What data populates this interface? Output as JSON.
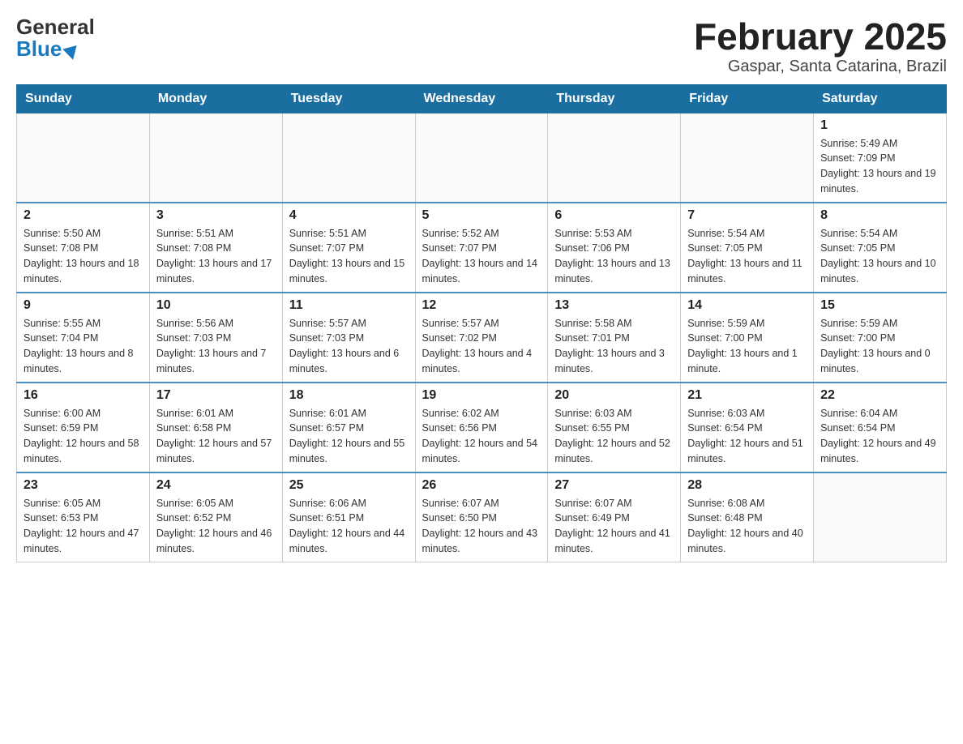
{
  "header": {
    "logo_general": "General",
    "logo_blue": "Blue",
    "month_title": "February 2025",
    "location": "Gaspar, Santa Catarina, Brazil"
  },
  "days_of_week": [
    "Sunday",
    "Monday",
    "Tuesday",
    "Wednesday",
    "Thursday",
    "Friday",
    "Saturday"
  ],
  "weeks": [
    [
      {
        "day": "",
        "info": ""
      },
      {
        "day": "",
        "info": ""
      },
      {
        "day": "",
        "info": ""
      },
      {
        "day": "",
        "info": ""
      },
      {
        "day": "",
        "info": ""
      },
      {
        "day": "",
        "info": ""
      },
      {
        "day": "1",
        "info": "Sunrise: 5:49 AM\nSunset: 7:09 PM\nDaylight: 13 hours and 19 minutes."
      }
    ],
    [
      {
        "day": "2",
        "info": "Sunrise: 5:50 AM\nSunset: 7:08 PM\nDaylight: 13 hours and 18 minutes."
      },
      {
        "day": "3",
        "info": "Sunrise: 5:51 AM\nSunset: 7:08 PM\nDaylight: 13 hours and 17 minutes."
      },
      {
        "day": "4",
        "info": "Sunrise: 5:51 AM\nSunset: 7:07 PM\nDaylight: 13 hours and 15 minutes."
      },
      {
        "day": "5",
        "info": "Sunrise: 5:52 AM\nSunset: 7:07 PM\nDaylight: 13 hours and 14 minutes."
      },
      {
        "day": "6",
        "info": "Sunrise: 5:53 AM\nSunset: 7:06 PM\nDaylight: 13 hours and 13 minutes."
      },
      {
        "day": "7",
        "info": "Sunrise: 5:54 AM\nSunset: 7:05 PM\nDaylight: 13 hours and 11 minutes."
      },
      {
        "day": "8",
        "info": "Sunrise: 5:54 AM\nSunset: 7:05 PM\nDaylight: 13 hours and 10 minutes."
      }
    ],
    [
      {
        "day": "9",
        "info": "Sunrise: 5:55 AM\nSunset: 7:04 PM\nDaylight: 13 hours and 8 minutes."
      },
      {
        "day": "10",
        "info": "Sunrise: 5:56 AM\nSunset: 7:03 PM\nDaylight: 13 hours and 7 minutes."
      },
      {
        "day": "11",
        "info": "Sunrise: 5:57 AM\nSunset: 7:03 PM\nDaylight: 13 hours and 6 minutes."
      },
      {
        "day": "12",
        "info": "Sunrise: 5:57 AM\nSunset: 7:02 PM\nDaylight: 13 hours and 4 minutes."
      },
      {
        "day": "13",
        "info": "Sunrise: 5:58 AM\nSunset: 7:01 PM\nDaylight: 13 hours and 3 minutes."
      },
      {
        "day": "14",
        "info": "Sunrise: 5:59 AM\nSunset: 7:00 PM\nDaylight: 13 hours and 1 minute."
      },
      {
        "day": "15",
        "info": "Sunrise: 5:59 AM\nSunset: 7:00 PM\nDaylight: 13 hours and 0 minutes."
      }
    ],
    [
      {
        "day": "16",
        "info": "Sunrise: 6:00 AM\nSunset: 6:59 PM\nDaylight: 12 hours and 58 minutes."
      },
      {
        "day": "17",
        "info": "Sunrise: 6:01 AM\nSunset: 6:58 PM\nDaylight: 12 hours and 57 minutes."
      },
      {
        "day": "18",
        "info": "Sunrise: 6:01 AM\nSunset: 6:57 PM\nDaylight: 12 hours and 55 minutes."
      },
      {
        "day": "19",
        "info": "Sunrise: 6:02 AM\nSunset: 6:56 PM\nDaylight: 12 hours and 54 minutes."
      },
      {
        "day": "20",
        "info": "Sunrise: 6:03 AM\nSunset: 6:55 PM\nDaylight: 12 hours and 52 minutes."
      },
      {
        "day": "21",
        "info": "Sunrise: 6:03 AM\nSunset: 6:54 PM\nDaylight: 12 hours and 51 minutes."
      },
      {
        "day": "22",
        "info": "Sunrise: 6:04 AM\nSunset: 6:54 PM\nDaylight: 12 hours and 49 minutes."
      }
    ],
    [
      {
        "day": "23",
        "info": "Sunrise: 6:05 AM\nSunset: 6:53 PM\nDaylight: 12 hours and 47 minutes."
      },
      {
        "day": "24",
        "info": "Sunrise: 6:05 AM\nSunset: 6:52 PM\nDaylight: 12 hours and 46 minutes."
      },
      {
        "day": "25",
        "info": "Sunrise: 6:06 AM\nSunset: 6:51 PM\nDaylight: 12 hours and 44 minutes."
      },
      {
        "day": "26",
        "info": "Sunrise: 6:07 AM\nSunset: 6:50 PM\nDaylight: 12 hours and 43 minutes."
      },
      {
        "day": "27",
        "info": "Sunrise: 6:07 AM\nSunset: 6:49 PM\nDaylight: 12 hours and 41 minutes."
      },
      {
        "day": "28",
        "info": "Sunrise: 6:08 AM\nSunset: 6:48 PM\nDaylight: 12 hours and 40 minutes."
      },
      {
        "day": "",
        "info": ""
      }
    ]
  ]
}
